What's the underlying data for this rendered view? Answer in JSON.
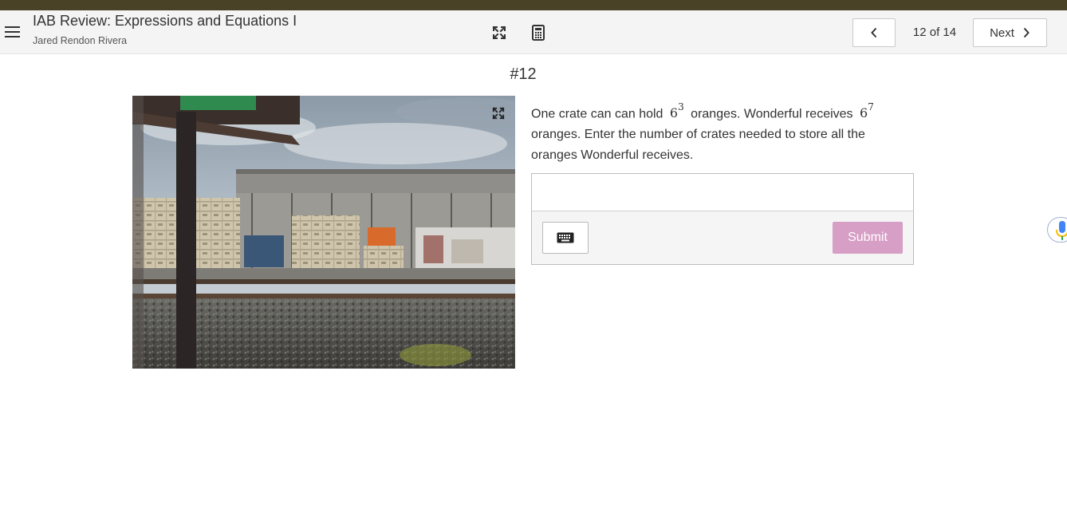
{
  "header": {
    "title": "IAB Review: Expressions and Equations I",
    "subtitle": "Jared Rendon Rivera",
    "menu_icon": "hamburger-menu-icon",
    "fullscreen_icon": "expand-arrows-icon",
    "calculator_icon": "calculator-icon",
    "page_counter": "12 of 14",
    "next_label": "Next"
  },
  "question": {
    "number": "#12",
    "text_part1": "One crate can can hold",
    "base1": "6",
    "exp1": "3",
    "text_part2": "oranges. Wonderful receives",
    "base2": "6",
    "exp2": "7",
    "text_part3": "oranges. Enter the number of crates needed to store all the oranges Wonderful receives."
  },
  "answer": {
    "value": "",
    "placeholder": "",
    "submit_label": "Submit",
    "keyboard_icon": "keyboard-icon"
  },
  "colors": {
    "top_stripe": "#4a4226",
    "submit_disabled": "#d79ec6",
    "header_bg": "#f4f4f4"
  }
}
